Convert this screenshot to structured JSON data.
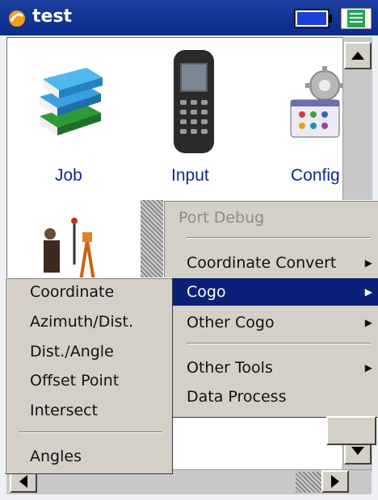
{
  "window": {
    "title": "test",
    "colors": {
      "titlebar": "#0b2b8a",
      "menu_bg": "#d4d0c8",
      "selection": "#0a2079",
      "icon_label": "#0c2b8a"
    }
  },
  "status_icons": [
    "battery-icon",
    "notes-icon"
  ],
  "desktop_icons": [
    {
      "label": "Job",
      "icon": "books-icon"
    },
    {
      "label": "Input",
      "icon": "handheld-device-icon"
    },
    {
      "label": "Config",
      "icon": "gear-settings-icon"
    },
    {
      "label": "",
      "icon": "surveyor-icon"
    }
  ],
  "main_menu": {
    "items": [
      {
        "label": "Port Debug",
        "disabled": true
      },
      {
        "label": "Coordinate Convert",
        "submenu": true
      },
      {
        "label": "Cogo",
        "submenu": true,
        "selected": true
      },
      {
        "label": "Other Cogo",
        "submenu": true
      },
      {
        "label": "Other Tools",
        "submenu": true
      },
      {
        "label": "Data Process"
      }
    ]
  },
  "cogo_submenu": {
    "items": [
      {
        "label": "Coordinate"
      },
      {
        "label": "Azimuth/Dist."
      },
      {
        "label": "Dist./Angle"
      },
      {
        "label": "Offset Point"
      },
      {
        "label": "Intersect"
      },
      {
        "label": "Angles"
      }
    ]
  }
}
